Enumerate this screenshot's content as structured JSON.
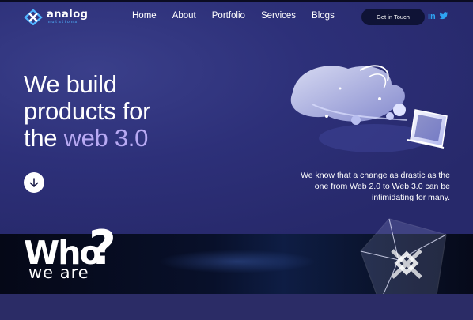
{
  "brand": {
    "name": "analog",
    "sub": "mutations"
  },
  "nav": {
    "items": [
      {
        "label": "Home"
      },
      {
        "label": "About"
      },
      {
        "label": "Portfolio"
      },
      {
        "label": "Services"
      },
      {
        "label": "Blogs"
      }
    ],
    "cta_label": "Get in Touch",
    "social": {
      "linkedin": "in",
      "twitter_icon": "twitter-icon"
    }
  },
  "hero": {
    "headline_line1": "We build",
    "headline_line2": "products for",
    "headline_line3_prefix": "the",
    "headline_accent": "web 3.0",
    "tagline": "We know that a change as drastic as the one from Web 2.0 to Web 3.0 can be intimidating for many.",
    "scroll_icon": "arrow-down-icon"
  },
  "who": {
    "title": "Who",
    "question_mark": "?",
    "subtitle": "we are"
  },
  "colors": {
    "background": "#2d3079",
    "accent": "#b8a9f3",
    "brand_blue": "#4fb3ff",
    "cta_bg": "#0f1336",
    "social": "#2ea3f2"
  }
}
